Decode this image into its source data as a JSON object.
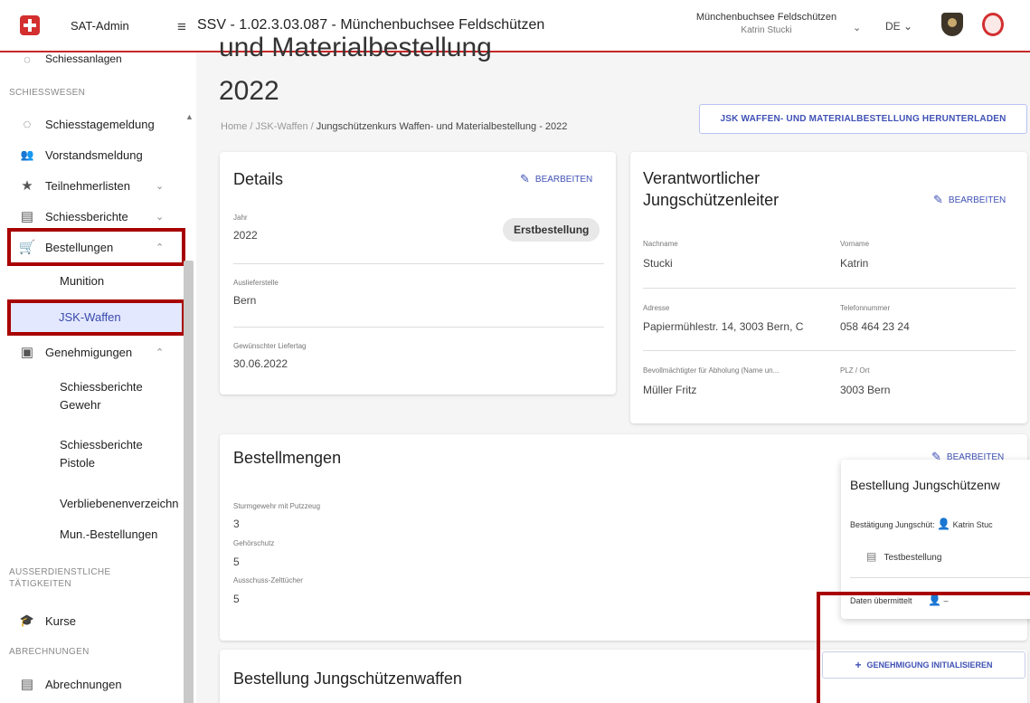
{
  "topbar": {
    "app_name": "SAT-Admin",
    "page_heading": "SSV - 1.02.3.03.087 - Münchenbuchsee Feldschützen",
    "user_org": "Münchenbuchsee Feldschützen",
    "user_name": "Katrin Stucki",
    "language": "DE"
  },
  "sidebar": {
    "partial_item": "Schiessanlagen",
    "section_schiesswesen": "SCHIESSWESEN",
    "items": {
      "schiesstagemeldung": "Schiesstagemeldung",
      "vorstandsmeldung": "Vorstandsmeldung",
      "teilnehmerlisten": "Teilnehmerlisten",
      "schiessberichte": "Schiessberichte",
      "bestellungen": "Bestellungen",
      "munition": "Munition",
      "jsk_waffen": "JSK-Waffen",
      "genehmigungen": "Genehmigungen",
      "schiessberichte_gewehr": "Schiessberichte Gewehr",
      "schiessberichte_pistole": "Schiessberichte Pistole",
      "verbliebenenverzeichnis": "Verbliebenenverzeichn",
      "mun_bestellungen": "Mun.-Bestellungen",
      "kurse": "Kurse",
      "abrechnungen": "Abrechnungen"
    },
    "section_ausserdienstliche": "AUSSERDIENSTLICHE TÄTIGKEITEN",
    "section_abrechnungen": "ABRECHNUNGEN"
  },
  "main": {
    "title_partial": "und Materialbestellung",
    "title_year": "2022",
    "breadcrumb": {
      "home": "Home",
      "sep": "/",
      "jsk": "JSK-Waffen",
      "current": "Jungschützenkurs Waffen- und Materialbestellung - 2022"
    },
    "download_button": "JSK WAFFEN- UND MATERIALBESTELLUNG HERUNTERLADEN"
  },
  "details": {
    "title": "Details",
    "edit": "BEARBEITEN",
    "jahr_label": "Jahr",
    "jahr_value": "2022",
    "chip": "Erstbestellung",
    "auslieferstelle_label": "Auslieferstelle",
    "auslieferstelle_value": "Bern",
    "liefertag_label": "Gewünschter Liefertag",
    "liefertag_value": "30.06.2022"
  },
  "leiter": {
    "title_line1": "Verantwortlicher",
    "title_line2": "Jungschützenleiter",
    "edit": "BEARBEITEN",
    "nachname_label": "Nachname",
    "nachname_value": "Stucki",
    "vorname_label": "Vorname",
    "vorname_value": "Katrin",
    "adresse_label": "Adresse",
    "adresse_value": "Papiermühlestr. 14, 3003 Bern, C",
    "telefon_label": "Telefonnummer",
    "telefon_value": "058 464 23 24",
    "bevollm_label": "Bevollmächtigter für Abholung (Name un...",
    "bevollm_value": "Müller Fritz",
    "plz_label": "PLZ / Ort",
    "plz_value": "3003 Bern"
  },
  "bestellmengen": {
    "title": "Bestellmengen",
    "edit": "BEARBEITEN",
    "sturmgewehr_label": "Sturmgewehr mit Putzzeug",
    "sturmgewehr_value": "3",
    "gehoerschutz_label": "Gehörschutz",
    "gehoerschutz_value": "5",
    "zelttuecher_label": "Ausschuss-Zelttücher",
    "zelttuecher_value": "5"
  },
  "popup": {
    "title": "Bestellung Jungschützenw",
    "bestaetigung_label": "Bestätigung Jungschüt:",
    "bestaetigung_value": "Katrin Stuc",
    "note": "Testbestellung",
    "daten_label": "Daten übermittelt",
    "daten_value": "–"
  },
  "waffen_section": {
    "title": "Bestellung Jungschützenwaffen",
    "init_button": "GENEHMIGUNG INITIALISIEREN"
  },
  "colors": {
    "accent": "#3f51b5",
    "highlight": "#a80000",
    "brand_red": "#d32f2f"
  }
}
